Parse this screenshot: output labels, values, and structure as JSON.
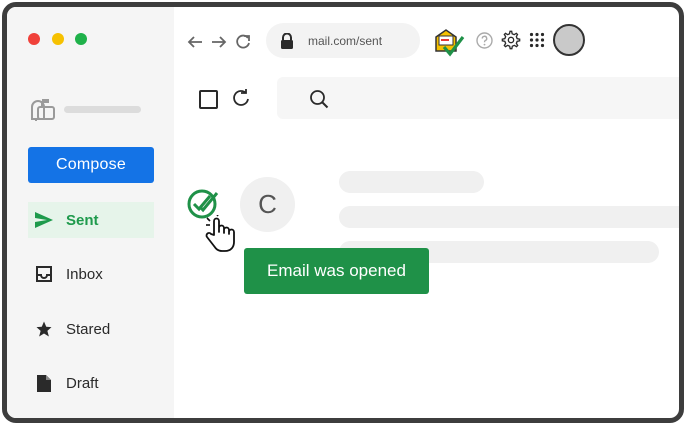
{
  "window": {
    "controls": [
      "close",
      "minimize",
      "maximize"
    ]
  },
  "browser": {
    "back_icon": "back-arrow-icon",
    "forward_icon": "forward-arrow-icon",
    "reload_icon": "reload-icon",
    "url": "mail.com/sent",
    "extension_icon": "mail-tracker-extension-icon",
    "help_icon": "help-icon",
    "settings_icon": "gear-icon",
    "apps_icon": "apps-grid-icon",
    "avatar_icon": "profile-avatar"
  },
  "sidebar": {
    "logo_icon": "mailbox-icon",
    "compose_label": "Compose",
    "items": [
      {
        "label": "Sent",
        "icon": "send-icon",
        "active": true
      },
      {
        "label": "Inbox",
        "icon": "inbox-icon",
        "active": false
      },
      {
        "label": "Stared",
        "icon": "star-icon",
        "active": false
      },
      {
        "label": "Draft",
        "icon": "draft-icon",
        "active": false
      }
    ]
  },
  "toolbar": {
    "select_icon": "checkbox",
    "refresh_icon": "refresh-icon",
    "search_icon": "search-icon"
  },
  "email": {
    "avatar_letter": "C",
    "status_icon": "double-check-icon",
    "tooltip": "Email was opened"
  },
  "colors": {
    "accent": "#1473e6",
    "success": "#1f9148",
    "active_bg": "#e6f4ea",
    "frame": "#3d3d3d"
  }
}
